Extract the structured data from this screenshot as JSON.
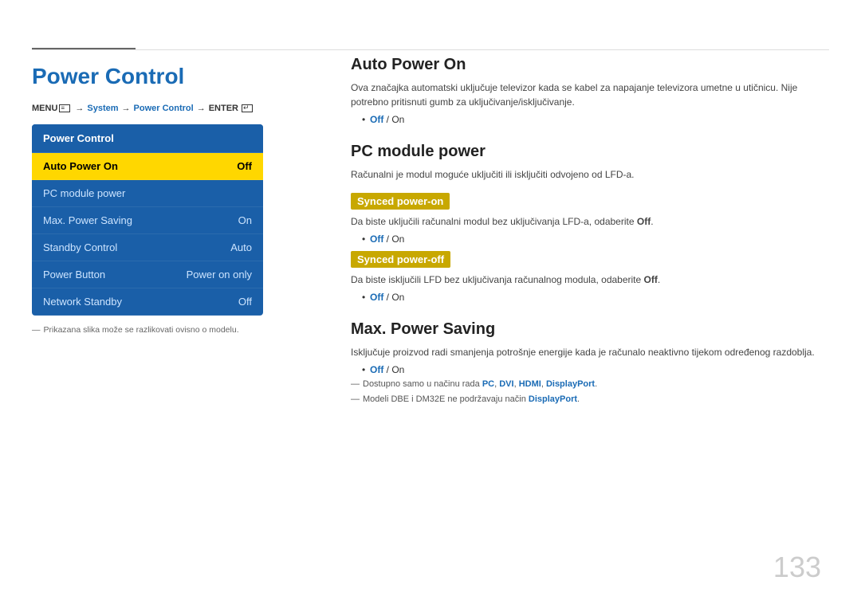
{
  "page": {
    "number": "133",
    "accent_color": "#1a6bb5",
    "gold_color": "#c8a800"
  },
  "header": {
    "menu_path": "MENU",
    "system": "System",
    "power_control_nav": "Power Control",
    "enter": "ENTER"
  },
  "left": {
    "title": "Power Control",
    "nav_box_title": "Power Control",
    "footnote": "Prikazana slika može se razlikovati ovisno o modelu.",
    "menu_items": [
      {
        "label": "Auto Power On",
        "value": "Off",
        "active": true
      },
      {
        "label": "PC module power",
        "value": "",
        "active": false
      },
      {
        "label": "Max. Power Saving",
        "value": "On",
        "active": false
      },
      {
        "label": "Standby Control",
        "value": "Auto",
        "active": false
      },
      {
        "label": "Power Button",
        "value": "Power on only",
        "active": false
      },
      {
        "label": "Network Standby",
        "value": "Off",
        "active": false
      }
    ]
  },
  "right": {
    "sections": [
      {
        "id": "auto-power-on",
        "title": "Auto Power On",
        "desc": "Ova značajka automatski uključuje televizor kada se kabel za napajanje televizora umetne u utičnicu. Nije potrebno pritisnuti gumb za uključivanje/isključivanje.",
        "bullets": [
          "Off / On"
        ],
        "subsections": []
      },
      {
        "id": "pc-module-power",
        "title": "PC module power",
        "desc": "Računalni je modul moguće uključiti ili isključiti odvojeno od LFD-a.",
        "bullets": [],
        "subsections": [
          {
            "label": "Synced power-on",
            "desc": "Da biste uključili računalni modul bez uključivanja LFD-a, odaberite Off.",
            "highlight_word": "Off",
            "bullets": [
              "Off / On"
            ]
          },
          {
            "label": "Synced power-off",
            "desc": "Da biste isključili LFD bez uključivanja računalnog modula, odaberite Off.",
            "highlight_word": "Off",
            "bullets": [
              "Off / On"
            ]
          }
        ]
      },
      {
        "id": "max-power-saving",
        "title": "Max. Power Saving",
        "desc": "Isključuje proizvod radi smanjenja potrošnje energije kada je računalo neaktivno tijekom određenog razdoblja.",
        "bullets": [
          "Off / On"
        ],
        "notes": [
          {
            "text": "Dostupno samo u načinu rada PC, DVI, HDMI, DisplayPort.",
            "links": [
              "PC",
              "DVI",
              "HDMI",
              "DisplayPort"
            ]
          },
          {
            "text": "Modeli DBE i DM32E ne podržavaju način DisplayPort.",
            "links": [
              "DisplayPort"
            ]
          }
        ],
        "subsections": []
      }
    ]
  }
}
